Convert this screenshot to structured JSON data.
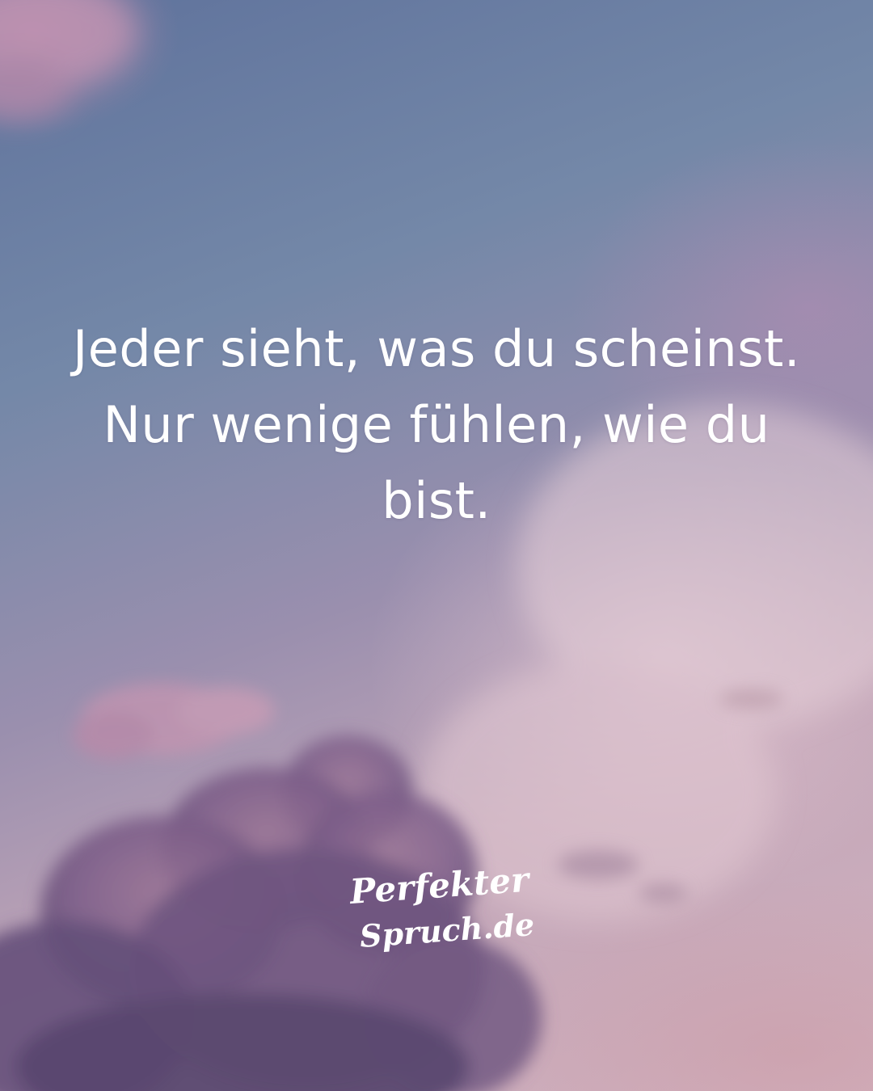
{
  "quote": {
    "lines": [
      "Jeder sieht, was du scheinst.",
      "Nur wenige fühlen, wie du",
      "bist."
    ]
  },
  "logo": {
    "line1": "Perfekter",
    "line2": "Spruch.de"
  },
  "colors": {
    "text": "#ffffff",
    "sky_top": "#5f729c",
    "sky_bottom": "#d2b2bf",
    "cloud_purple": "#7a5a86"
  }
}
